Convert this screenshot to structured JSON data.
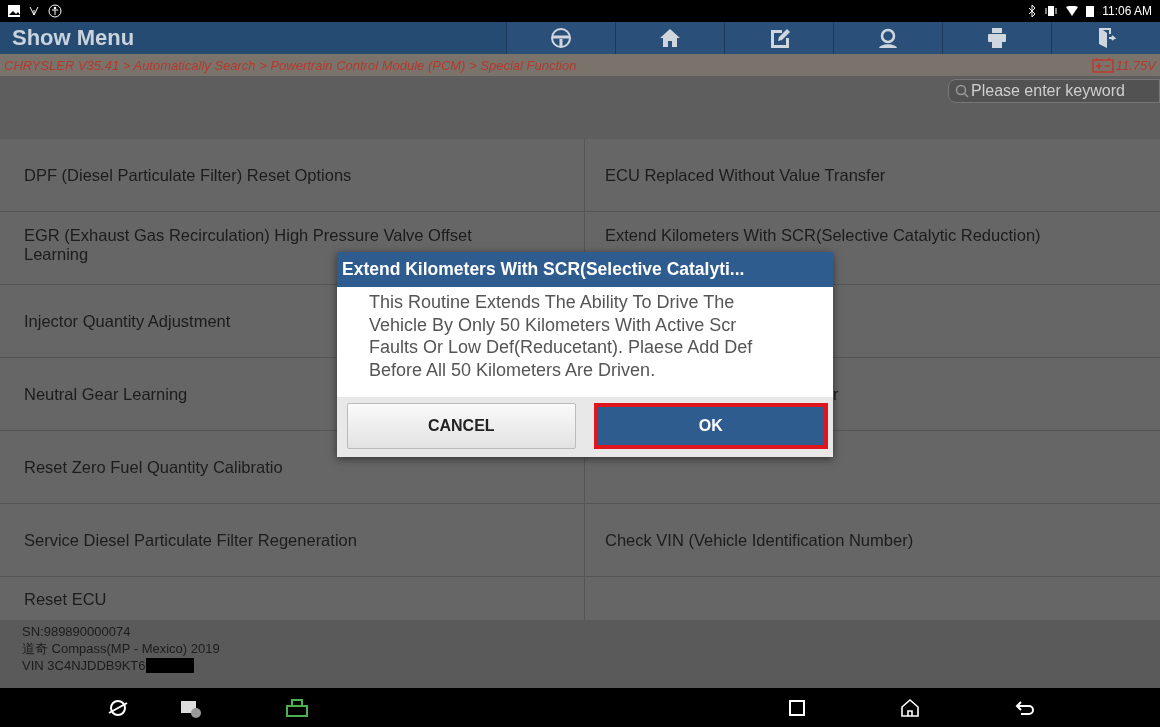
{
  "status_bar": {
    "time": "11:06 AM"
  },
  "header": {
    "title": "Show Menu"
  },
  "breadcrumb": {
    "path": "CHRYSLER V35.41 > Automatically Search > Powertrain Control Module (PCM) > Special Function",
    "voltage": "11.75V"
  },
  "search": {
    "placeholder": "Please enter keyword"
  },
  "menu": {
    "rows": [
      {
        "left": "DPF (Diesel Particulate Filter) Reset Options",
        "right": "ECU Replaced Without Value Transfer"
      },
      {
        "left": "EGR (Exhaust Gas Recirculation) High Pressure Valve Offset Learning",
        "right": "Extend Kilometers With SCR(Selective Catalytic Reduction)"
      },
      {
        "left": "Injector Quantity Adjustment",
        "right": ""
      },
      {
        "left": "Neutral Gear Learning",
        "right": "r"
      },
      {
        "left": "Reset Zero Fuel Quantity Calibratio",
        "right": ""
      },
      {
        "left": "Service Diesel Particulate Filter Regeneration",
        "right": "Check VIN (Vehicle Identification Number)"
      },
      {
        "left": "Reset ECU",
        "right": ""
      }
    ]
  },
  "vehicle_info": {
    "serial": "SN:989890000074",
    "model": "道奇 Compass(MP - Mexico) 2019",
    "vin": "VIN 3C4NJDDB9KT6"
  },
  "dialog": {
    "title": "Extend Kilometers With SCR(Selective Catalyti...",
    "message": "This Routine Extends The Ability To Drive The Vehicle By Only 50 Kilometers With Active Scr Faults Or Low Def(Reducetant).  Plaese Add Def Before All 50 Kilometers Are Driven.",
    "buttons": [
      {
        "label": "CANCEL",
        "selected": false
      },
      {
        "label": "OK",
        "selected": true
      }
    ]
  }
}
